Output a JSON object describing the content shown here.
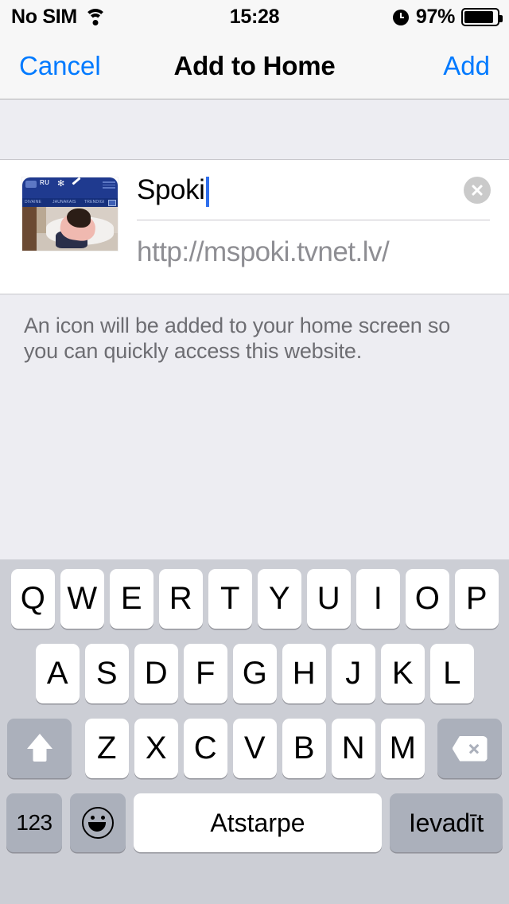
{
  "status_bar": {
    "carrier": "No SIM",
    "wifi_icon": "wifi-icon",
    "time": "15:28",
    "alarm_icon": "alarm-clock-icon",
    "battery_percent": "97%",
    "battery_icon": "battery-icon",
    "battery_level": 90
  },
  "nav_bar": {
    "cancel_label": "Cancel",
    "title": "Add to Home",
    "add_label": "Add",
    "accent_color": "#007aff"
  },
  "form": {
    "thumbnail_icon": "website-thumbnail",
    "thumbnail_site": {
      "lang_label": "RU",
      "nav_items": [
        "DIVAINE",
        "JAUNAKAIS",
        "TRENDIGI"
      ]
    },
    "title_value": "Spoki",
    "clear_icon": "clear-text-icon",
    "url_value": "http://mspoki.tvnet.lv/"
  },
  "footer_note": "An icon will be added to your home screen so you can quickly access this website.",
  "keyboard": {
    "row1": [
      "Q",
      "W",
      "E",
      "R",
      "T",
      "Y",
      "U",
      "I",
      "O",
      "P"
    ],
    "row2": [
      "A",
      "S",
      "D",
      "F",
      "G",
      "H",
      "J",
      "K",
      "L"
    ],
    "row3": [
      "Z",
      "X",
      "C",
      "V",
      "B",
      "N",
      "M"
    ],
    "shift_icon": "shift-arrow-icon",
    "delete_icon": "backspace-icon",
    "numbers_label": "123",
    "emoji_icon": "emoji-smiley-icon",
    "space_label": "Atstarpe",
    "enter_label": "Ievadīt",
    "background_color": "#ccced5"
  }
}
